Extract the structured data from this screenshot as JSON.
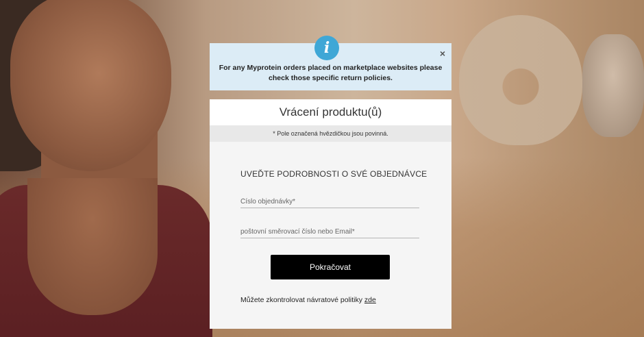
{
  "banner": {
    "message": "For any Myprotein orders placed on marketplace websites please check those specific return policies.",
    "info_icon": "i",
    "close_icon": "×"
  },
  "form": {
    "title": "Vrácení produktu(ů)",
    "required_note": "* Pole označená hvězdičkou jsou povinná.",
    "section_title": "UVEĎTE PODROBNOSTI O SVÉ OBJEDNÁVCE",
    "order_number": {
      "placeholder": "Číslo objednávky*",
      "value": ""
    },
    "postcode_email": {
      "placeholder": "poštovní směrovací číslo nebo Email*",
      "value": ""
    },
    "continue_label": "Pokračovat",
    "policy_text": "Můžete zkontrolovat návratové politiky ",
    "policy_link": "zde"
  },
  "colors": {
    "banner_bg": "#dcecf6",
    "info_icon": "#3fa7d6",
    "button_bg": "#000000",
    "card_bg": "#f5f5f5"
  }
}
